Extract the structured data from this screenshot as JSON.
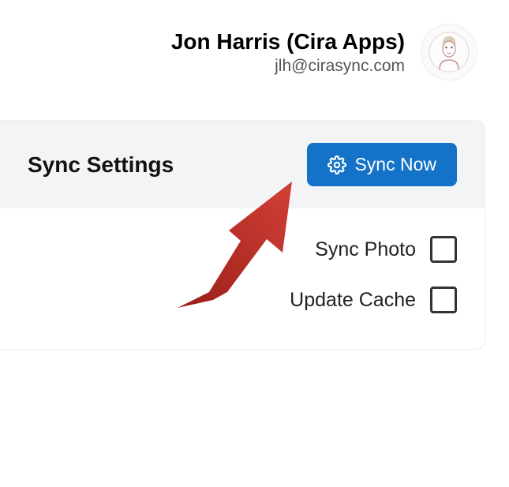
{
  "user": {
    "name": "Jon Harris (Cira Apps)",
    "email": "jlh@cirasync.com"
  },
  "panel": {
    "title": "Sync Settings",
    "sync_button_label": "Sync Now"
  },
  "options": {
    "sync_photo": "Sync Photo",
    "update_cache": "Update Cache"
  },
  "colors": {
    "primary": "#1473c8",
    "annotation": "#b82b22"
  }
}
